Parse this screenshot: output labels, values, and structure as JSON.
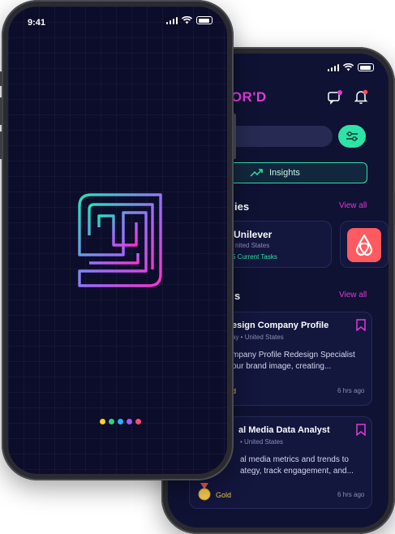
{
  "splash": {
    "time": "9:41",
    "page_dots": [
      "#ffd21e",
      "#35d07f",
      "#1fb6ff",
      "#9b5cff",
      "#ff4d6d"
    ]
  },
  "app": {
    "brand_partial": "SOR'D",
    "search_placeholder": "",
    "insights_label": "Insights",
    "companies_heading_partial": "ies",
    "view_all_companies": "View all",
    "company": {
      "name_partial": "Unilever",
      "location_partial": "nited States",
      "tasks_partial": "5 Current Tasks"
    },
    "tasks_heading_partial": "s",
    "view_all_tasks": "View all",
    "tasks": [
      {
        "title_partial": "esign Company Profile",
        "meta_partial": "ay • United States",
        "desc_line1": "mpany Profile Redesign Specialist",
        "desc_line2": "our brand image, creating...",
        "tier_partial": "d",
        "time": "6 hrs ago"
      },
      {
        "title_partial": "al Media Data Analyst",
        "meta_partial": "• United States",
        "desc_line1": "al media metrics and trends to",
        "desc_line2": "ategy, track engagement, and...",
        "tier": "Gold",
        "time": "6 hrs ago"
      }
    ]
  },
  "colors": {
    "accent_pink": "#e03ad6",
    "accent_green": "#2de3a6",
    "gold": "#f2c94c",
    "airbnb": "#ff5a5f"
  }
}
